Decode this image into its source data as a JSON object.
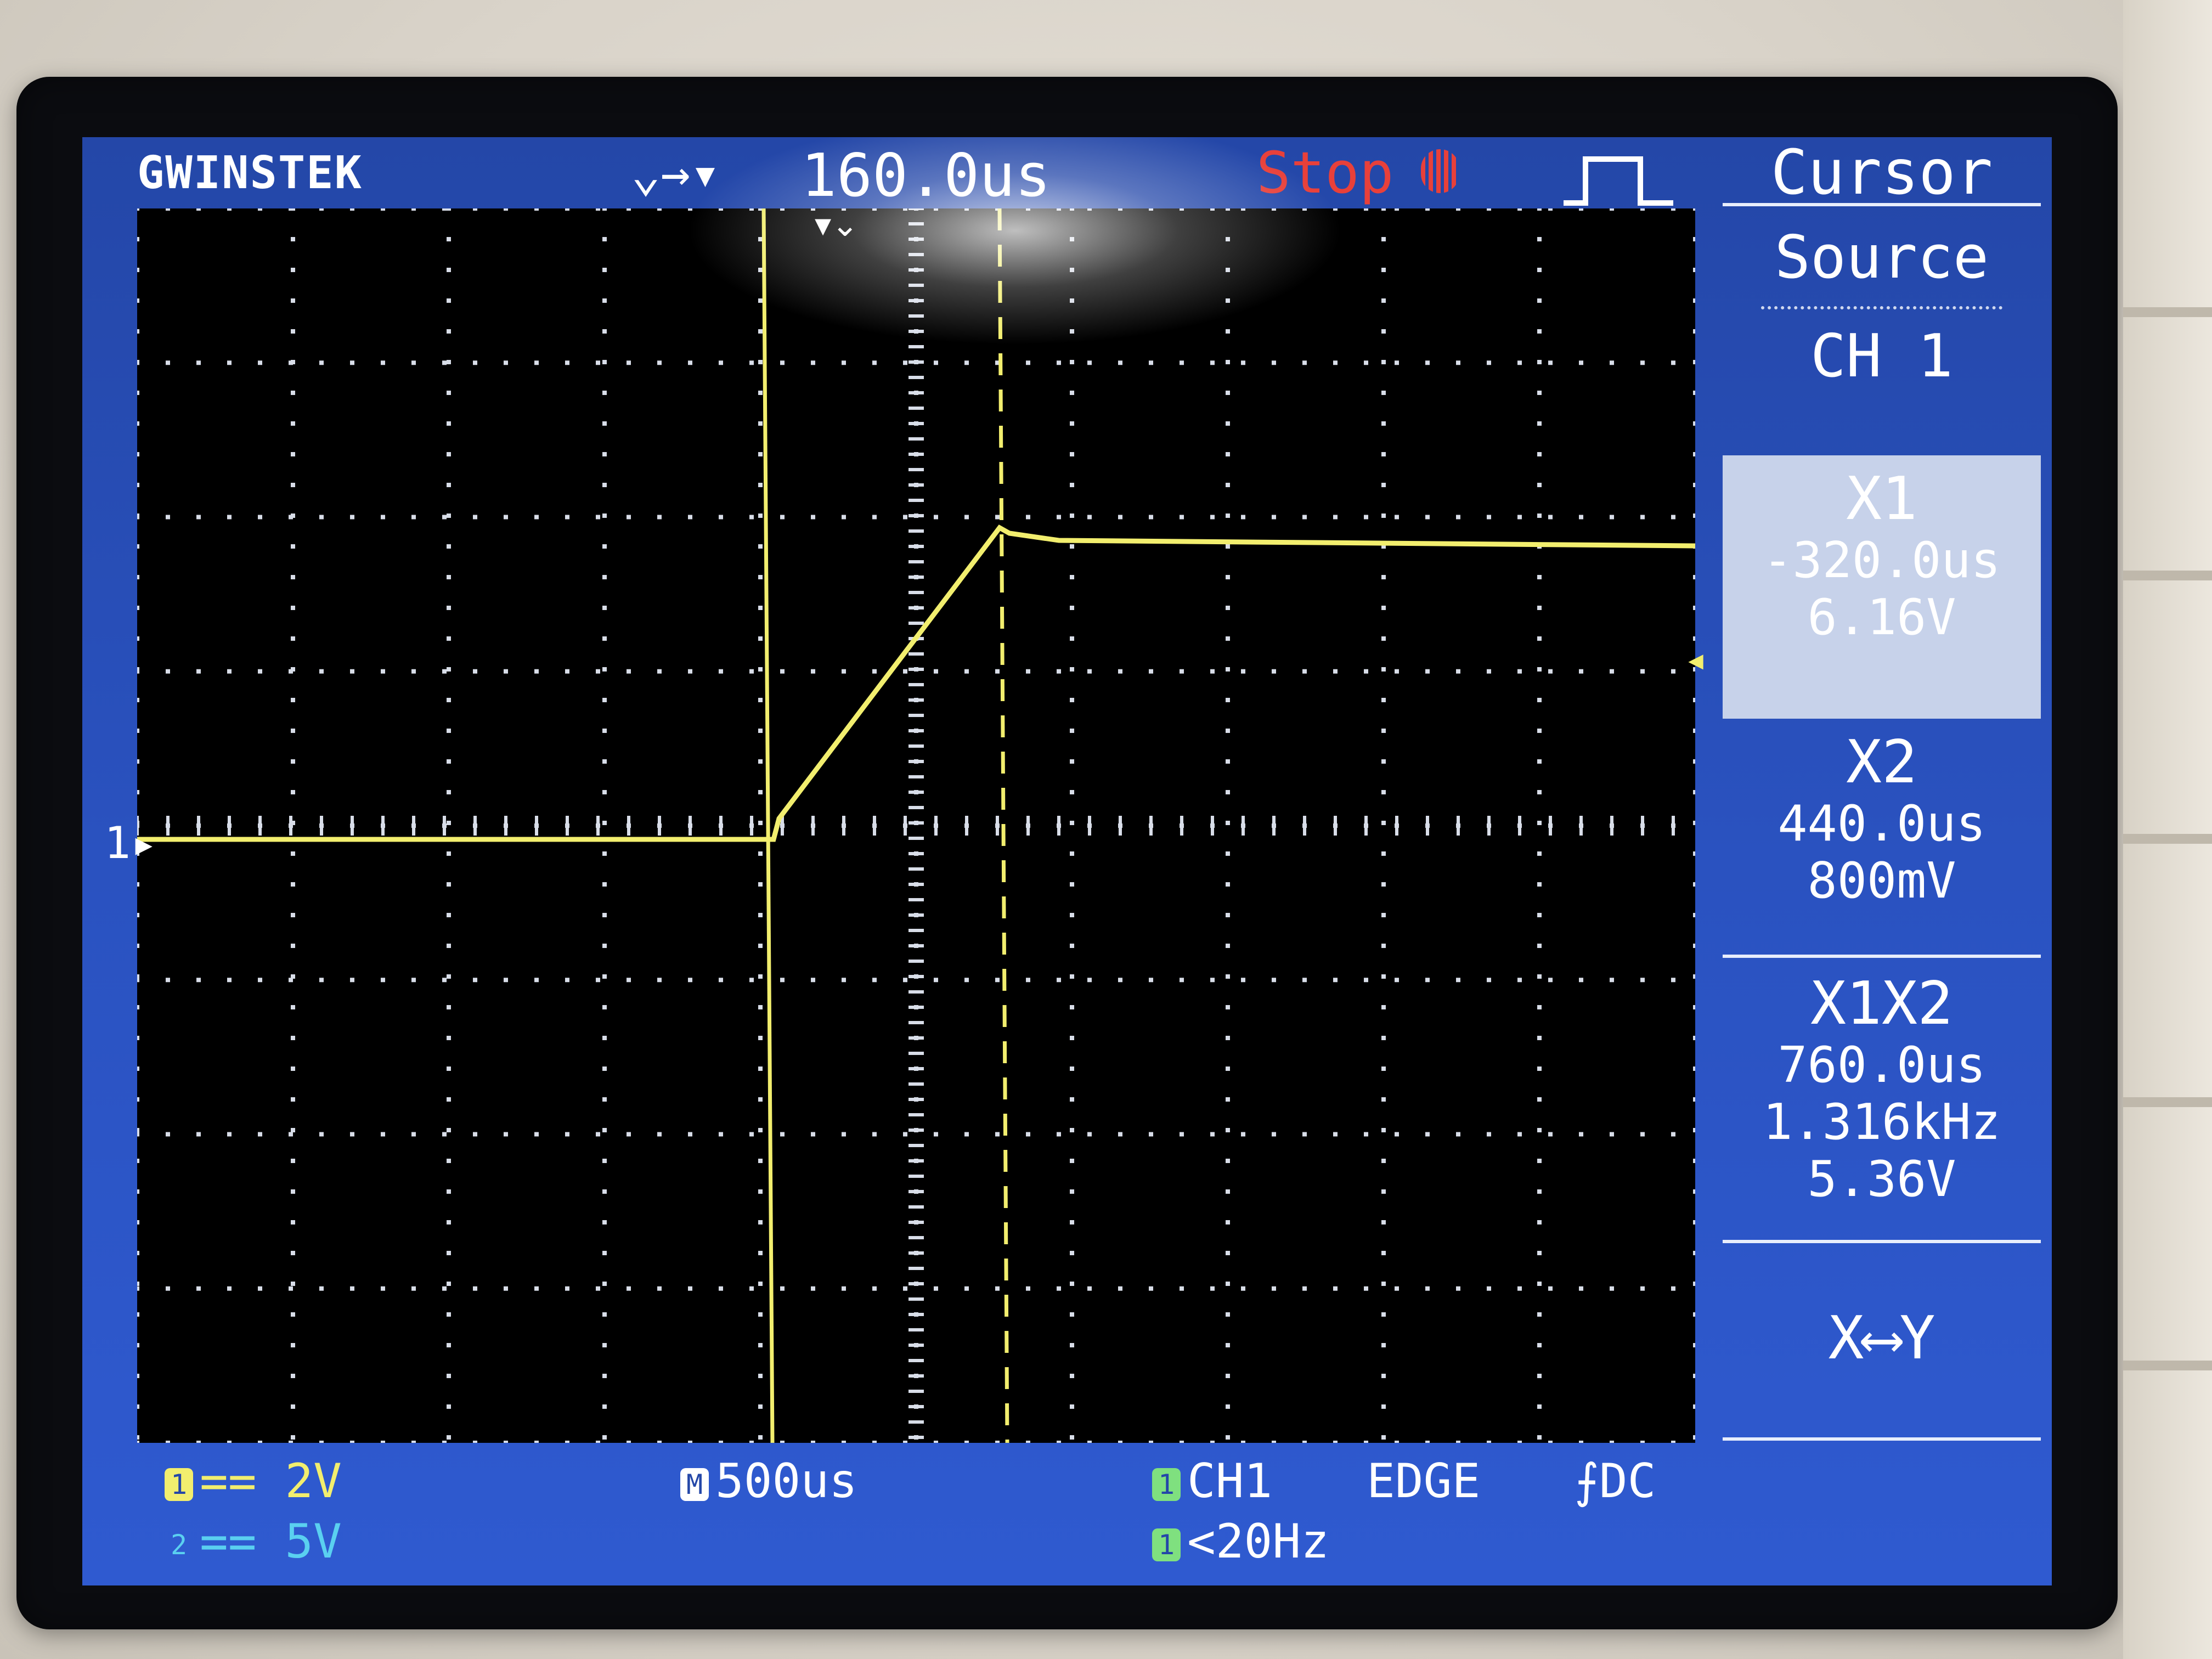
{
  "header": {
    "brand": "GWINSTEK",
    "trigger_position_icon": "⌄→▾",
    "trigger_position": "160.0us",
    "run_state": "Stop",
    "run_state_icon": "stop-icon",
    "trigger_edge_icon": "edge-pulse-icon"
  },
  "menu": {
    "title": "Cursor",
    "source_label": "Source",
    "source_value": "CH 1",
    "x1": {
      "label": "X1",
      "time": "-320.0us",
      "voltage": "6.16V",
      "selected": true
    },
    "x2": {
      "label": "X2",
      "time": "440.0us",
      "voltage": "800mV"
    },
    "x1x2": {
      "label": "X1X2",
      "delta_time": "760.0us",
      "frequency": "1.316kHz",
      "delta_voltage": "5.36V"
    },
    "swap_label": "X⟷Y"
  },
  "status": {
    "ch1_badge": "1",
    "ch1_scale": "== 2V",
    "ch2_badge": "2",
    "ch2_scale": "== 5V",
    "timebase_badge": "M",
    "timebase": "500us",
    "trigger_source_badge": "1",
    "trigger_source": "CH1",
    "trigger_type": "EDGE",
    "trigger_coupling": "⨍DC",
    "trigger_freq_badge": "1",
    "trigger_freq": "<20Hz"
  },
  "markers": {
    "ch1_ground_marker": "1▸",
    "trigger_level_marker": "◂"
  },
  "colors": {
    "screen_bg": "#2a52c0",
    "grid_bg": "#000000",
    "trace_ch1": "#f2ee6e",
    "run_state": "#e8403a",
    "ch2": "#5ad0f0"
  }
}
